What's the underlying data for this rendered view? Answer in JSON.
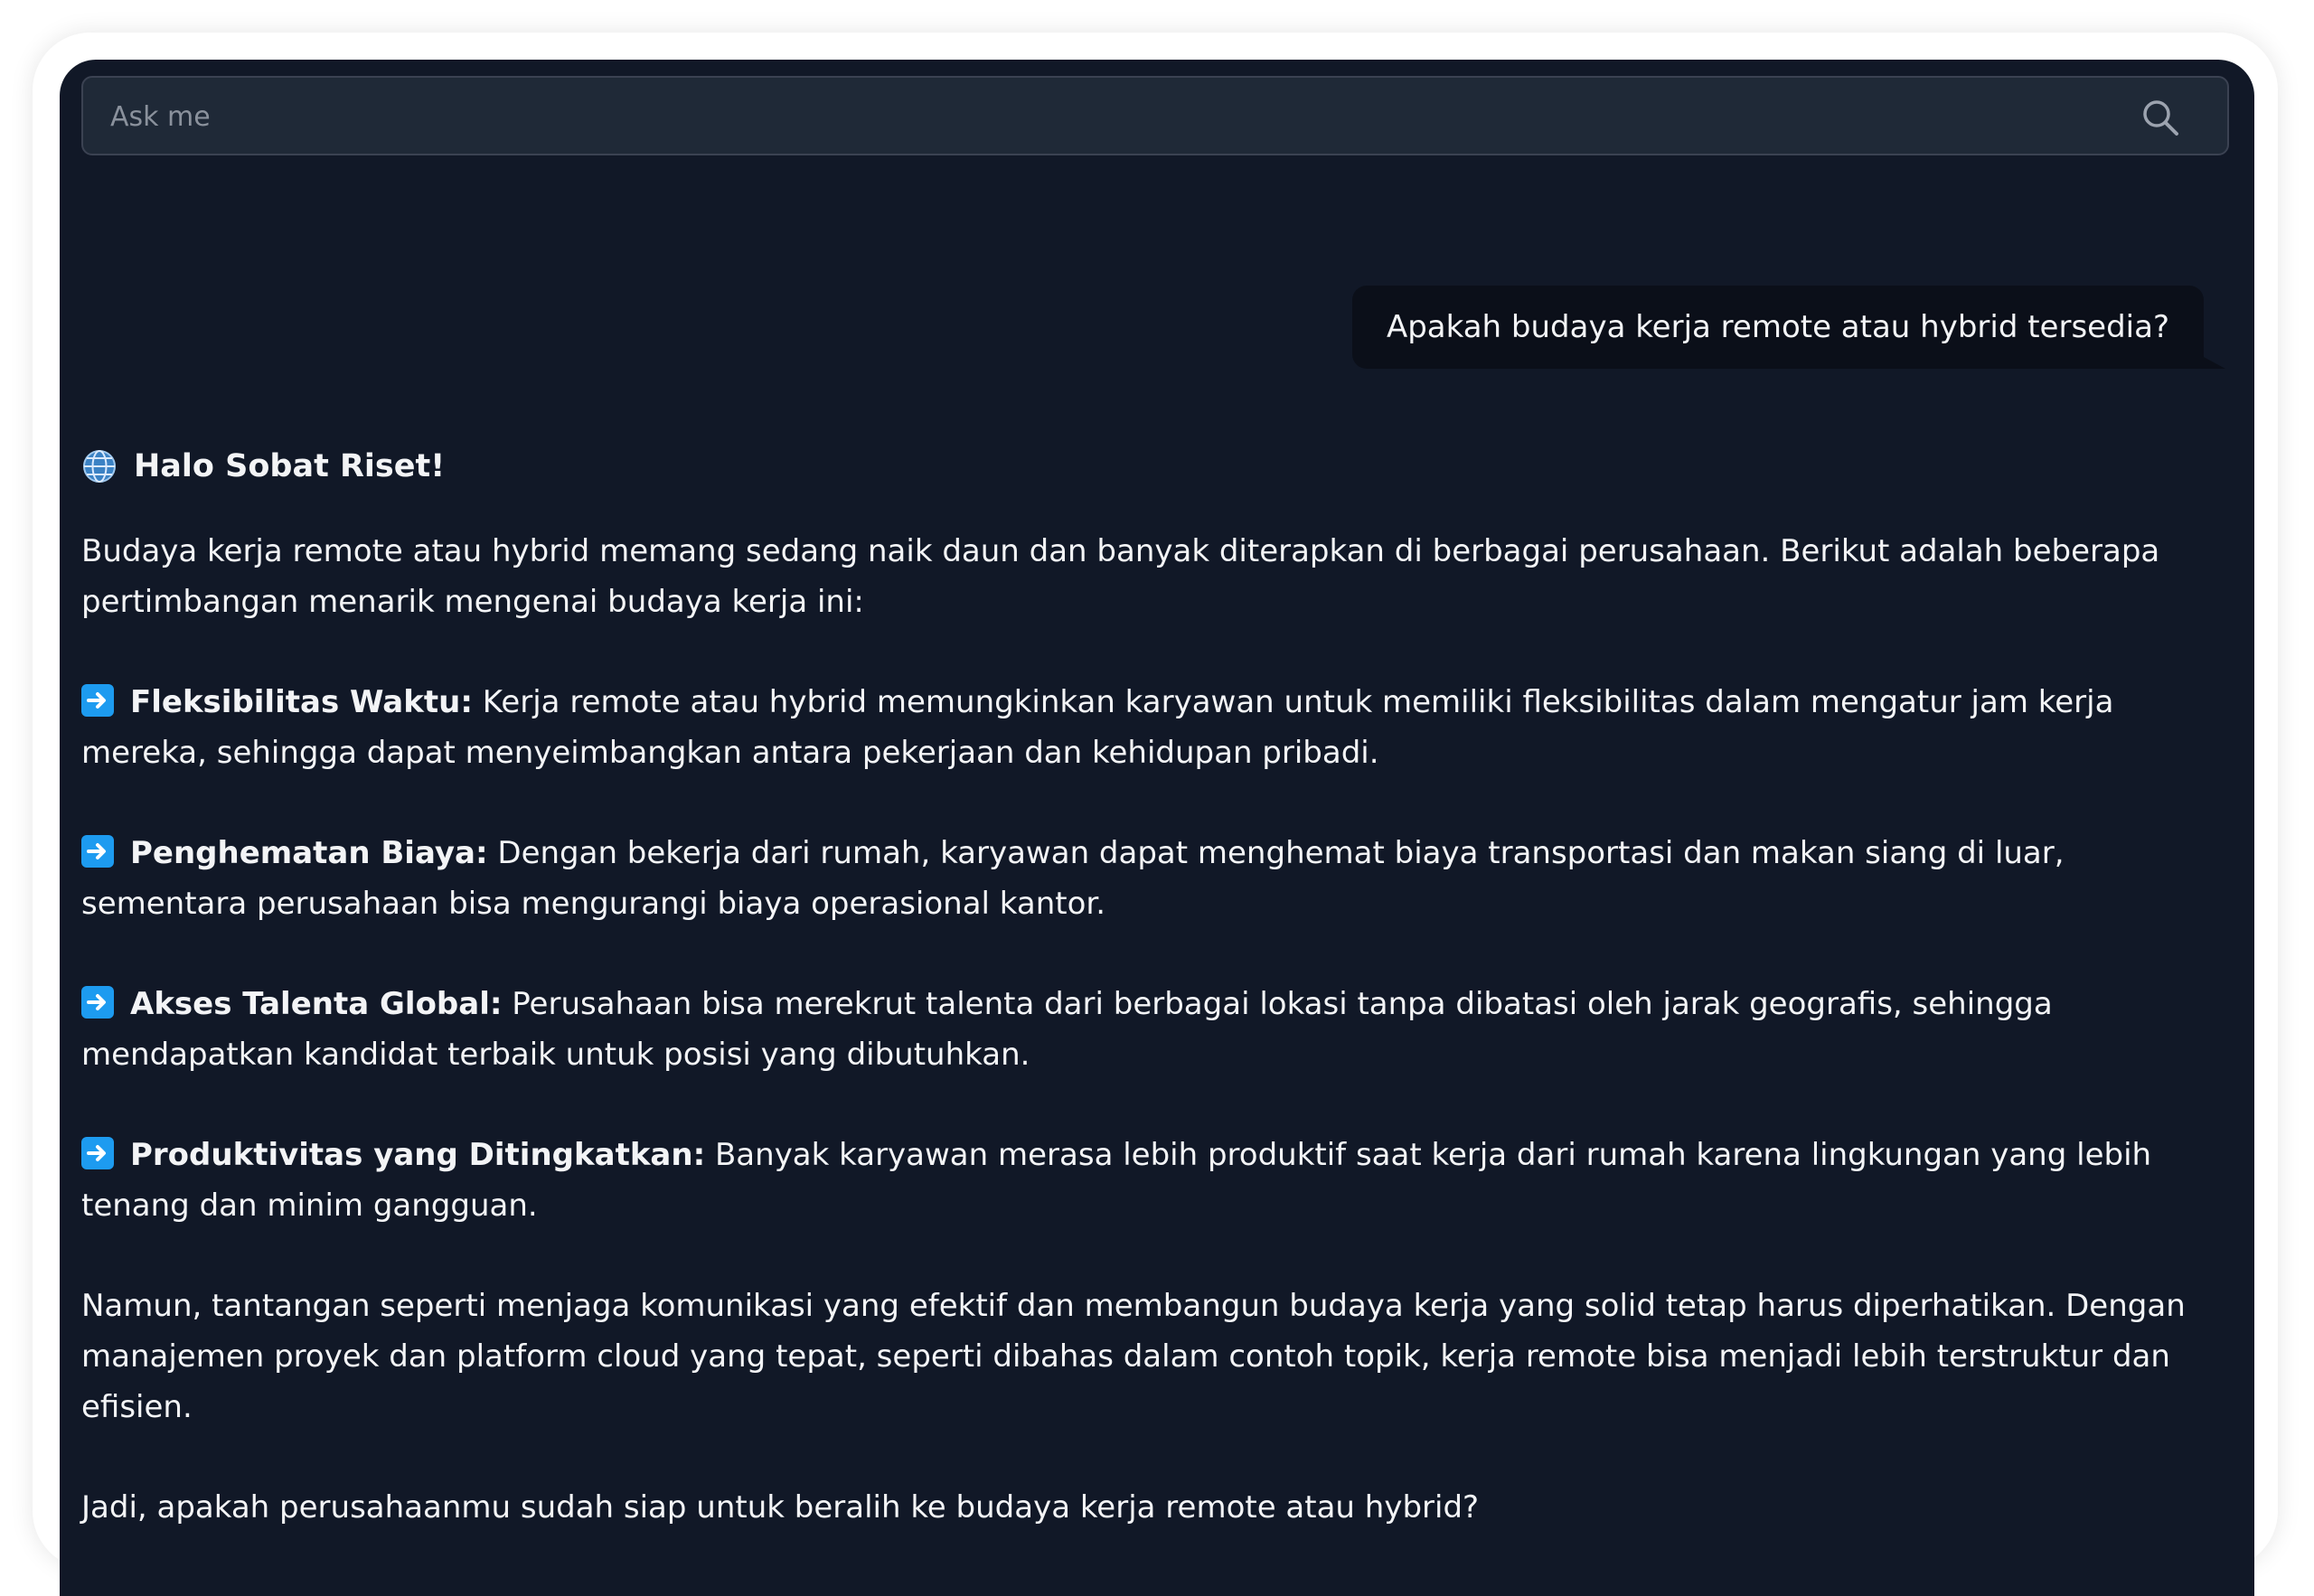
{
  "search": {
    "placeholder": "Ask me"
  },
  "conversation": {
    "user_message": "Apakah budaya kerja remote atau hybrid tersedia?",
    "reply": {
      "greeting": "Halo Sobat Riset!",
      "intro": "Budaya kerja remote atau hybrid memang sedang naik daun dan banyak diterapkan di berbagai perusahaan. Berikut adalah beberapa pertimbangan menarik mengenai budaya kerja ini:",
      "points": [
        {
          "title": "Fleksibilitas Waktu:",
          "text": " Kerja remote atau hybrid memungkinkan karyawan untuk memiliki fleksibilitas dalam mengatur jam kerja mereka, sehingga dapat menyeimbangkan antara pekerjaan dan kehidupan pribadi."
        },
        {
          "title": "Penghematan Biaya:",
          "text": " Dengan bekerja dari rumah, karyawan dapat menghemat biaya transportasi dan makan siang di luar, sementara perusahaan bisa mengurangi biaya operasional kantor."
        },
        {
          "title": "Akses Talenta Global:",
          "text": " Perusahaan bisa merekrut talenta dari berbagai lokasi tanpa dibatasi oleh jarak geografis, sehingga mendapatkan kandidat terbaik untuk posisi yang dibutuhkan."
        },
        {
          "title": "Produktivitas yang Ditingkatkan:",
          "text": " Banyak karyawan merasa lebih produktif saat kerja dari rumah karena lingkungan yang lebih tenang dan minim gangguan."
        }
      ],
      "closing": "Namun, tantangan seperti menjaga komunikasi yang efektif dan membangun budaya kerja yang solid tetap harus diperhatikan. Dengan manajemen proyek dan platform cloud yang tepat, seperti dibahas dalam contoh topik, kerja remote bisa menjadi lebih terstruktur dan efisien.",
      "question": "Jadi, apakah perusahaanmu sudah siap untuk beralih ke budaya kerja remote atau hybrid?"
    }
  },
  "icons": {
    "search": "search-icon",
    "greeting": "globe-icon",
    "bullet": "arrow-right-icon"
  },
  "colors": {
    "panel_background": "#111827",
    "search_background": "#1f2937",
    "user_bubble": "#0b0f19",
    "text": "#f3f4f6",
    "bullet_icon": "#1d9bf0"
  }
}
